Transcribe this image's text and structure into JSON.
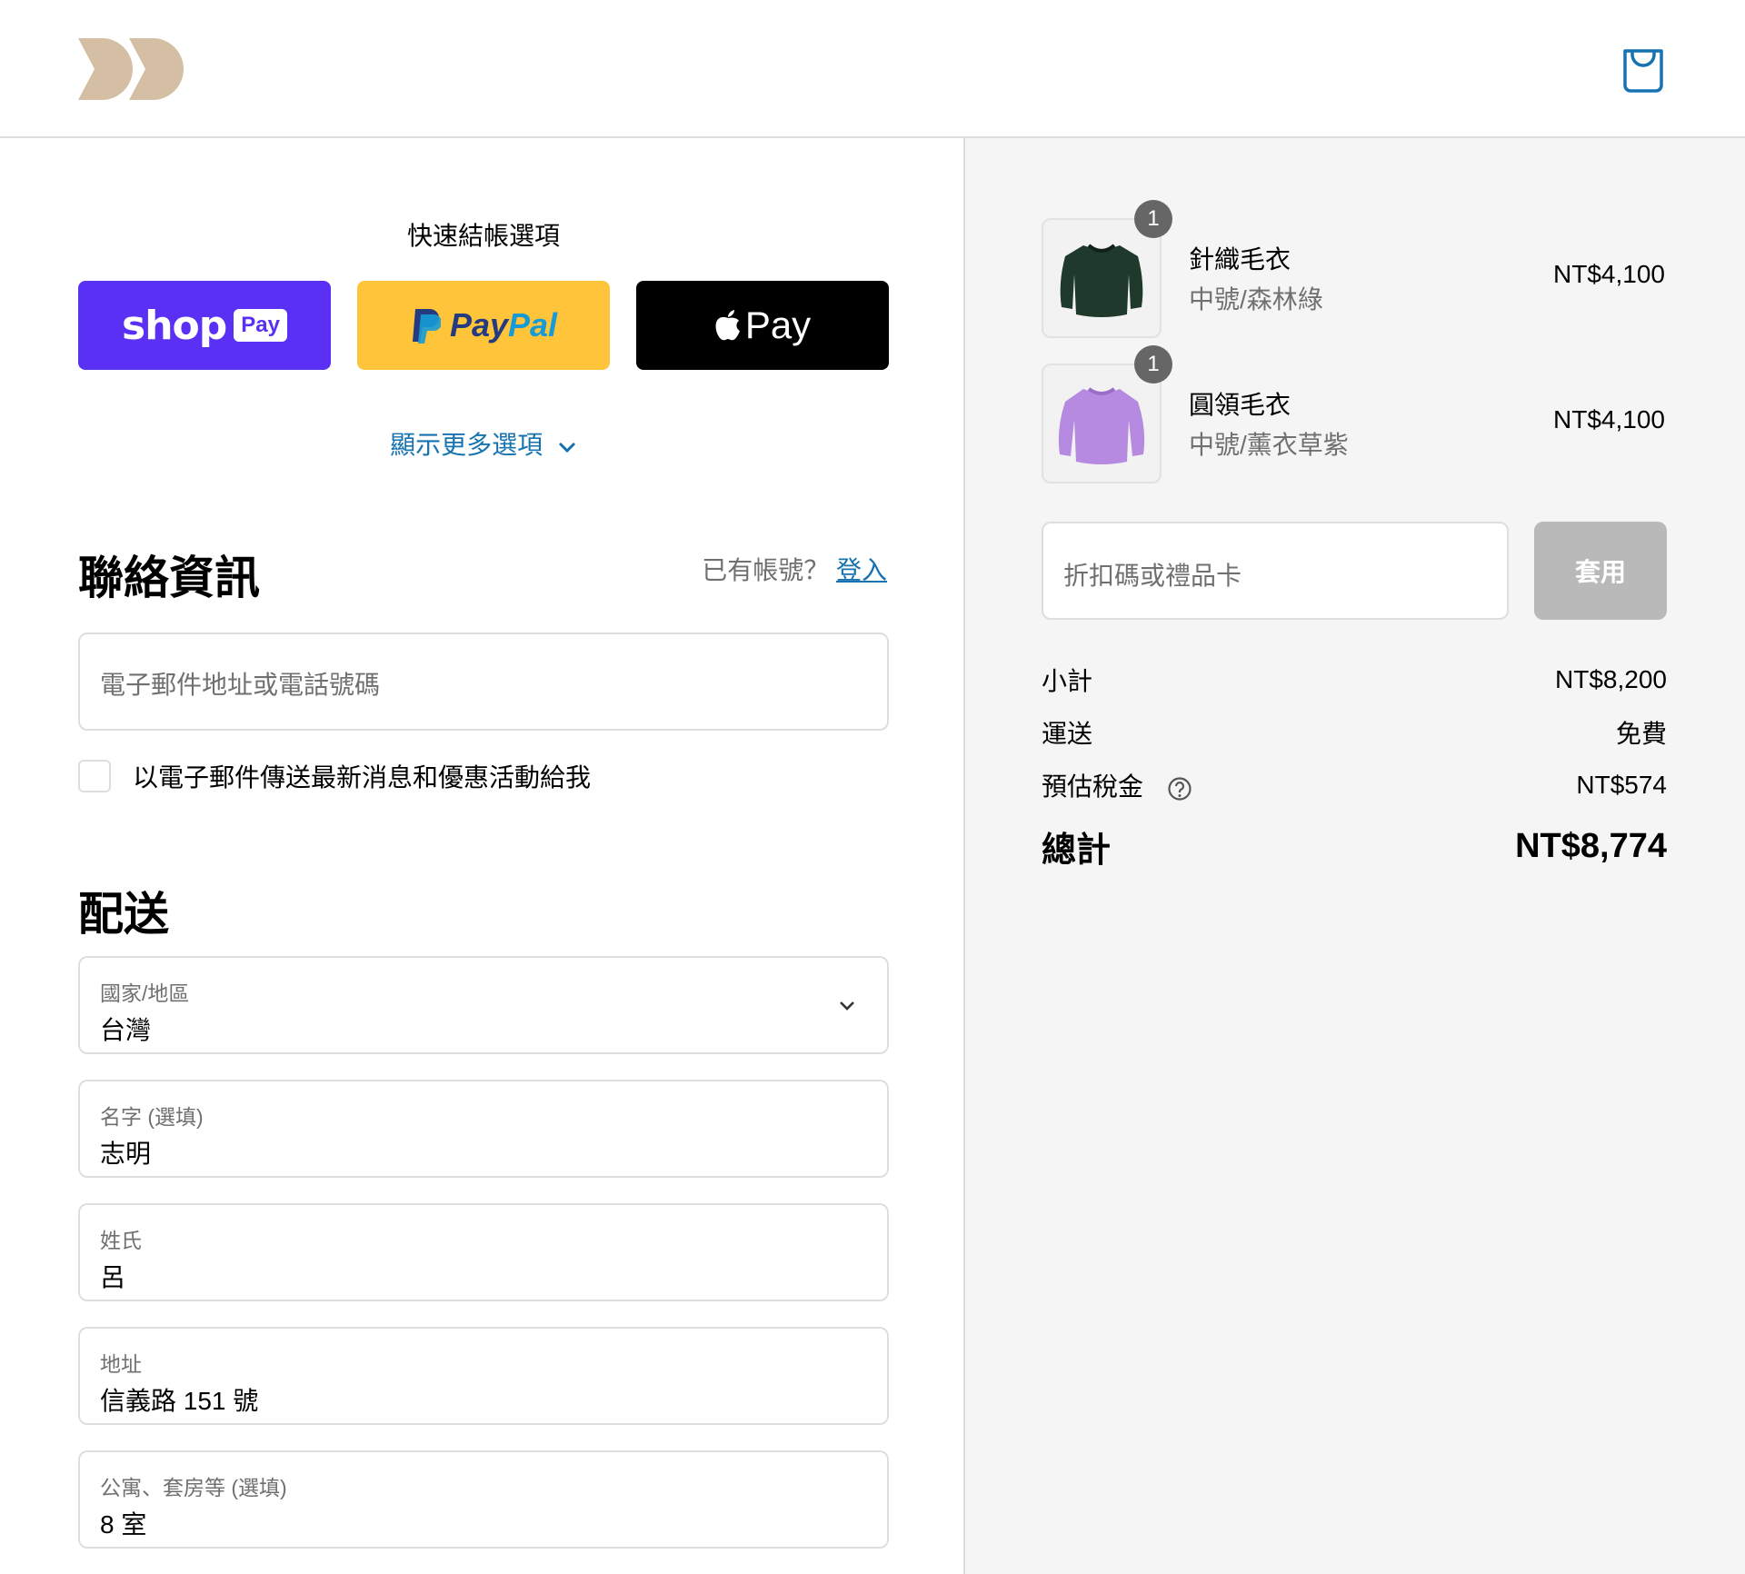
{
  "header": {
    "logo_icon": "brand-logo",
    "cart_icon": "shopping-bag-icon"
  },
  "colors": {
    "accent_link": "#1773b0",
    "shop_pay": "#5a31f4",
    "paypal": "#ffc439",
    "apple_pay": "#000000",
    "logo": "#d4bfa5"
  },
  "express": {
    "title": "快速結帳選項",
    "shop_word": "shop",
    "shop_chip": "Pay",
    "paypal_p1": "Pay",
    "paypal_p2": "Pal",
    "apple_word": "Pay",
    "show_more": "顯示更多選項"
  },
  "contact": {
    "title": "聯絡資訊",
    "have_account": "已有帳號？",
    "login": "登入",
    "email_placeholder": "電子郵件地址或電話號碼",
    "newsletter_label": "以電子郵件傳送最新消息和優惠活動給我"
  },
  "shipping": {
    "title": "配送",
    "country_label": "國家/地區",
    "country_value": "台灣",
    "first_name_label": "名字 (選填)",
    "first_name_value": "志明",
    "last_name_label": "姓氏",
    "last_name_value": "呂",
    "address_label": "地址",
    "address_value": "信義路 151 號",
    "apt_label": "公寓、套房等 (選填)",
    "apt_value": "8 室"
  },
  "summary": {
    "items": [
      {
        "qty": "1",
        "name": "針織毛衣",
        "variant": "中號/森林綠",
        "price": "NT$4,100",
        "color": "#1f3a2c"
      },
      {
        "qty": "1",
        "name": "圓領毛衣",
        "variant": "中號/薰衣草紫",
        "price": "NT$4,100",
        "color": "#b58ae0"
      }
    ],
    "discount_placeholder": "折扣碼或禮品卡",
    "apply": "套用",
    "subtotal_label": "小計",
    "subtotal_value": "NT$8,200",
    "shipping_label": "運送",
    "shipping_value": "免費",
    "tax_label": "預估稅金",
    "tax_value": "NT$574",
    "total_label": "總計",
    "total_value": "NT$8,774"
  }
}
